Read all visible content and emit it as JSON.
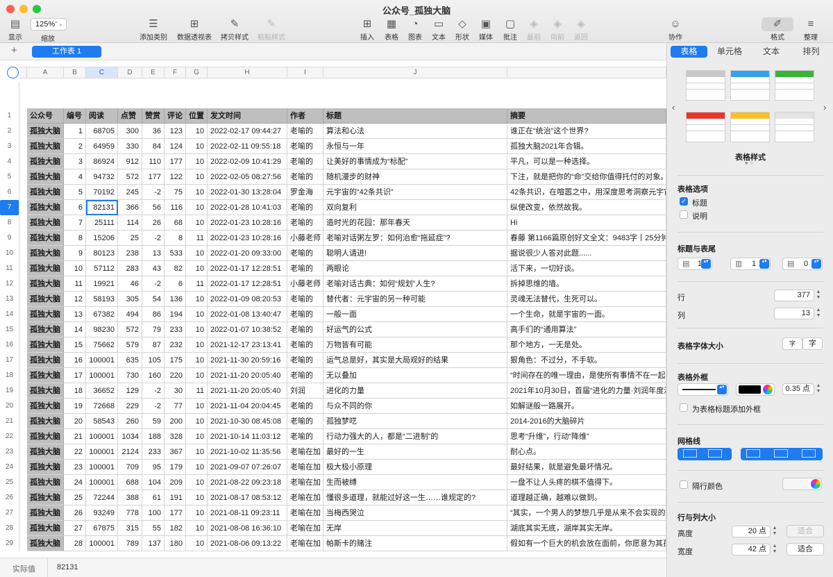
{
  "window": {
    "title": "公众号_孤独大脑"
  },
  "toolbar": {
    "view": "显示",
    "zoom_value": "125%",
    "zoom": "缩放",
    "add_category": "添加类别",
    "pivot": "数据透视表",
    "copy_style": "拷贝样式",
    "paste_style": "粘贴样式",
    "insert": "插入",
    "table": "表格",
    "chart": "图表",
    "text": "文本",
    "shape": "形状",
    "media": "媒体",
    "comment": "批注",
    "front": "最前",
    "forward": "向前",
    "back": "返回",
    "collaborate": "协作",
    "format": "格式",
    "organize": "整理"
  },
  "sheet_tabs": {
    "add": "+",
    "active": "工作表 1"
  },
  "columns": {
    "letters": [
      "A",
      "B",
      "C",
      "D",
      "E",
      "F",
      "G",
      "H",
      "I",
      "J"
    ]
  },
  "table": {
    "headers": [
      "公众号",
      "编号",
      "阅读",
      "点赞",
      "赞赏",
      "评论",
      "位置",
      "发文时间",
      "作者",
      "标题",
      "摘要"
    ],
    "rows": [
      [
        "孤独大脑",
        "1",
        "68705",
        "300",
        "36",
        "123",
        "10",
        "2022-02-17 09:44:27",
        "老喻的",
        "算法和心法",
        "谁正在“统治”这个世界?"
      ],
      [
        "孤独大脑",
        "2",
        "64959",
        "330",
        "84",
        "124",
        "10",
        "2022-02-11 09:55:18",
        "老喻的",
        "永恒与一年",
        "孤独大脑2021年合辑。"
      ],
      [
        "孤独大脑",
        "3",
        "86924",
        "912",
        "110",
        "177",
        "10",
        "2022-02-09 10:41:29",
        "老喻的",
        "让美好的事情成为“标配”",
        "平凡，可以是一种选择。"
      ],
      [
        "孤独大脑",
        "4",
        "94732",
        "572",
        "177",
        "122",
        "10",
        "2022-02-05 08:27:56",
        "老喻的",
        "随机漫步的财神",
        "下注，就是把你的“命”交给你值得托付的对象。"
      ],
      [
        "孤独大脑",
        "5",
        "70192",
        "245",
        "-2",
        "75",
        "10",
        "2022-01-30 13:28:04",
        "罗金海",
        "元宇宙的“42条共识”",
        "42条共识，在喧嚣之中，用深度思考洞察元宇宙"
      ],
      [
        "孤独大脑",
        "6",
        "82131",
        "366",
        "56",
        "116",
        "10",
        "2022-01-28 10:41:03",
        "老喻的",
        "双向复利",
        "纵使改变，依然故我。"
      ],
      [
        "孤独大脑",
        "7",
        "25111",
        "114",
        "26",
        "68",
        "10",
        "2022-01-23 10:28:16",
        "老喻的",
        "造时光的花园：那年春天",
        "Hi"
      ],
      [
        "孤独大脑",
        "8",
        "15206",
        "25",
        "-2",
        "8",
        "11",
        "2022-01-23 10:28:16",
        "小藤老师",
        "老喻对话粥左罗：如何治愈“拖延症”?",
        "春藤 第1166篇原创好文全文：9483字丨25分钟"
      ],
      [
        "孤独大脑",
        "9",
        "80123",
        "238",
        "13",
        "533",
        "10",
        "2022-01-20 09:33:00",
        "老喻的",
        "聪明人请进!",
        "据说很少人答对此题......"
      ],
      [
        "孤独大脑",
        "10",
        "57112",
        "283",
        "43",
        "82",
        "10",
        "2022-01-17 12:28:51",
        "老喻的",
        "两眼论",
        "活下来，一切好谈。"
      ],
      [
        "孤独大脑",
        "11",
        "19921",
        "46",
        "-2",
        "6",
        "11",
        "2022-01-17 12:28:51",
        "小藤老师",
        "老喻对话古典：如何“规划”人生?",
        "拆掉思维的墙。"
      ],
      [
        "孤独大脑",
        "12",
        "58193",
        "305",
        "54",
        "136",
        "10",
        "2022-01-09 08:20:53",
        "老喻的",
        "替代者：元宇宙的另一种可能",
        "灵魂无法替代，生死可以。"
      ],
      [
        "孤独大脑",
        "13",
        "67382",
        "494",
        "86",
        "194",
        "10",
        "2022-01-08 13:40:47",
        "老喻的",
        "一般一面",
        "一个生命，就是宇宙的一面。"
      ],
      [
        "孤独大脑",
        "14",
        "98230",
        "572",
        "79",
        "233",
        "10",
        "2022-01-07 10:38:52",
        "老喻的",
        "好运气的公式",
        "高手们的“通用算法”"
      ],
      [
        "孤独大脑",
        "15",
        "75662",
        "579",
        "87",
        "232",
        "10",
        "2021-12-17 23:13:41",
        "老喻的",
        "万物皆有可能",
        "那个地方，一无是处。"
      ],
      [
        "孤独大脑",
        "16",
        "100001",
        "635",
        "105",
        "175",
        "10",
        "2021-11-30 20:59:16",
        "老喻的",
        "运气总是好，其实是大局观好的结果",
        "狠角色：不过分，不手软。"
      ],
      [
        "孤独大脑",
        "17",
        "100001",
        "730",
        "160",
        "220",
        "10",
        "2021-11-20 20:05:40",
        "老喻的",
        "无以叠加",
        "“时间存在的唯一理由，是使所有事情不在一起发"
      ],
      [
        "孤独大脑",
        "18",
        "36652",
        "129",
        "-2",
        "30",
        "11",
        "2021-11-20 20:05:40",
        "刘润",
        "进化的力量",
        "2021年10月30日，首届“进化的力量·刘润年度演"
      ],
      [
        "孤独大脑",
        "19",
        "72668",
        "229",
        "-2",
        "77",
        "10",
        "2021-11-04 20:04:45",
        "老喻的",
        "与众不同的你",
        "如解谜般一路展开。"
      ],
      [
        "孤独大脑",
        "20",
        "58543",
        "260",
        "59",
        "200",
        "10",
        "2021-10-30 08:45:08",
        "老喻的",
        "孤独梦呓",
        "2014-2016的大脑碎片"
      ],
      [
        "孤独大脑",
        "21",
        "100001",
        "1034",
        "188",
        "328",
        "10",
        "2021-10-14 11:03:12",
        "老喻的",
        "行动力强大的人，都是“二进制”的",
        "思考“升维”，行动“降维”"
      ],
      [
        "孤独大脑",
        "22",
        "100001",
        "2124",
        "233",
        "367",
        "10",
        "2021-10-02 11:35:56",
        "老喻在加",
        "最好的一生",
        "耐心点。"
      ],
      [
        "孤独大脑",
        "23",
        "100001",
        "709",
        "95",
        "179",
        "10",
        "2021-09-07 07:26:07",
        "老喻在加",
        "极大极小原理",
        "最好结果，就是避免最坏情况。"
      ],
      [
        "孤独大脑",
        "24",
        "100001",
        "688",
        "104",
        "209",
        "10",
        "2021-08-22 09:23:18",
        "老喻在加",
        "生而被缚",
        "一盘不让人头疼的棋不值得下。"
      ],
      [
        "孤独大脑",
        "25",
        "72244",
        "388",
        "61",
        "191",
        "10",
        "2021-08-17 08:53:12",
        "老喻在加",
        "懂很多道理，就能过好这一生……谁规定的?",
        "道理越正确，越难以做到。"
      ],
      [
        "孤独大脑",
        "26",
        "93249",
        "778",
        "100",
        "177",
        "10",
        "2021-08-11 09:23:11",
        "老喻在加",
        "当梅西哭泣",
        "“其实，一个男人的梦想几乎是从来不会实现的。"
      ],
      [
        "孤独大脑",
        "27",
        "67875",
        "315",
        "55",
        "182",
        "10",
        "2021-08-08 16:36:10",
        "老喻在加",
        "无岸",
        "湖底其实无底，湖岸其实无岸。"
      ],
      [
        "孤独大脑",
        "28",
        "100001",
        "789",
        "137",
        "180",
        "10",
        "2021-08-06 09:13:22",
        "老喻在加",
        "帕斯卡的赌注",
        "假如有一个巨大的机会放在面前，你愿意为其孤"
      ]
    ]
  },
  "status": {
    "label": "实际值",
    "value": "82131"
  },
  "inspector": {
    "tabs": [
      "表格",
      "单元格",
      "文本",
      "排列"
    ],
    "styles_label": "表格样式",
    "options_title": "表格选项",
    "opt_title": "标题",
    "opt_caption": "说明",
    "headers_footers": "标题与表尾",
    "hdr_rows": "1",
    "hdr_cols": "1",
    "footer_rows": "0",
    "rows_label": "行",
    "rows_value": "377",
    "cols_label": "列",
    "cols_value": "13",
    "font_size_label": "表格字体大小",
    "font_small": "字",
    "font_large": "字",
    "outline_title": "表格外框",
    "outline_width": "0.35 点",
    "outline_title_chk": "为表格标题添加外框",
    "gridlines": "网格线",
    "alt_rows": "隔行颜色",
    "rowcol_size": "行与列大小",
    "height_label": "高度",
    "height_value": "20 点",
    "fit": "适合",
    "width_label": "宽度",
    "width_value": "42 点",
    "fit2": "适合"
  },
  "colors": {
    "accent": "#1f7bf0",
    "header_gray": "#bfbfbf"
  }
}
